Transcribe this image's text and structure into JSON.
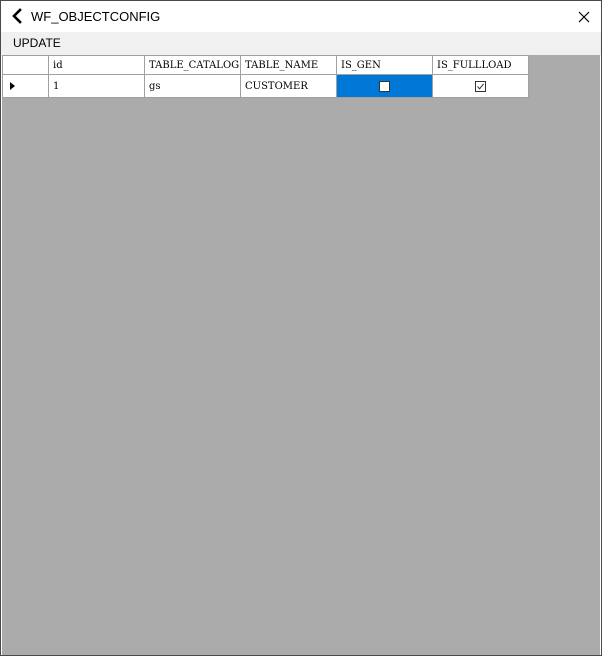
{
  "window": {
    "title": "WF_OBJECTCONFIG",
    "back_icon": "chevron-left-icon",
    "close_icon": "close-icon"
  },
  "menu": {
    "items": [
      {
        "label": "UPDATE"
      }
    ]
  },
  "grid": {
    "columns": [
      "id",
      "TABLE_CATALOG",
      "TABLE_NAME",
      "IS_GEN",
      "IS_FULLLOAD"
    ],
    "rows": [
      {
        "current": true,
        "id": "1",
        "table_catalog": "gs",
        "table_name": "CUSTOMER",
        "is_gen": false,
        "is_fullload": true
      }
    ],
    "selected_cell": "IS_GEN",
    "colors": {
      "selection": "#0078d7",
      "background": "#ababab",
      "gridline": "#a0a0a0"
    }
  }
}
